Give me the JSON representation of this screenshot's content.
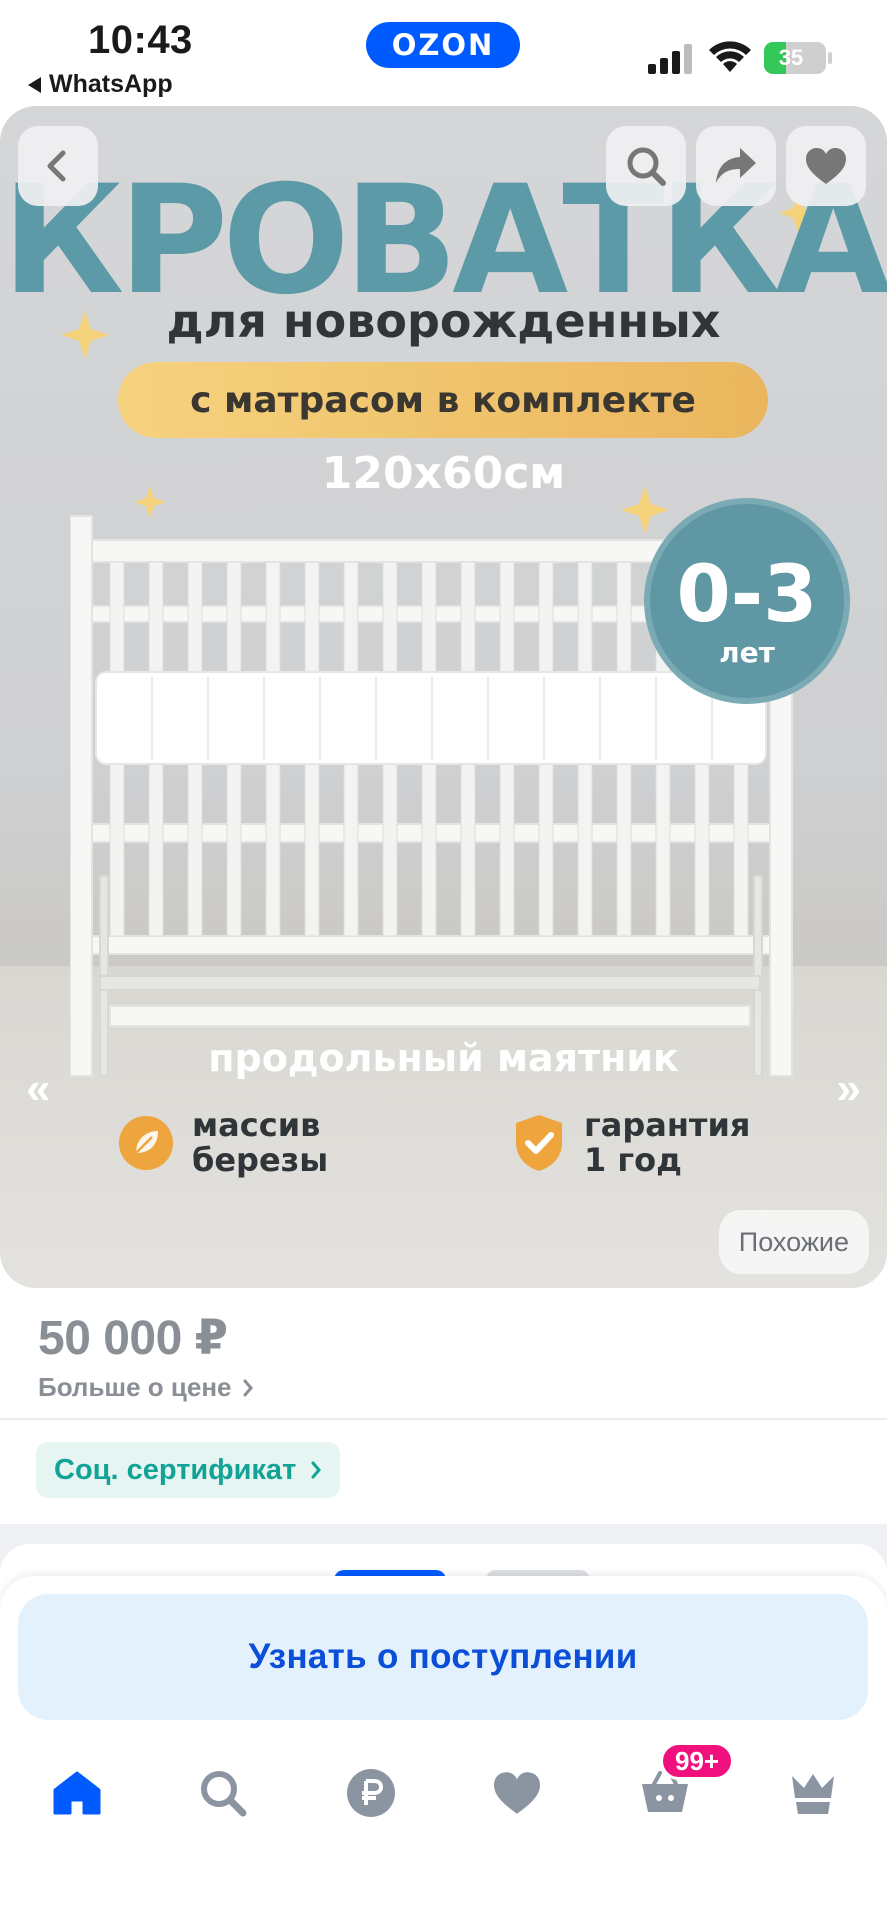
{
  "status_bar": {
    "time": "10:43",
    "back_app": "WhatsApp",
    "brand": "OZON",
    "battery_percent": "35",
    "battery_level": 0.35
  },
  "hero": {
    "title": "КРОВАТКА",
    "subtitle": "для новорожденных",
    "pill": "с матрасом в комплекте",
    "size": "120х60см",
    "age_value": "0-3",
    "age_unit": "лет",
    "pendulum": "продольный маятник",
    "feature_1_line1": "массив",
    "feature_1_line2": "березы",
    "feature_2_line1": "гарантия",
    "feature_2_line2": "1 год",
    "similar_label": "Похожие",
    "arrow_left": "«",
    "arrow_right": "»"
  },
  "icons": {
    "back": "chevron-left-icon",
    "search": "search-icon",
    "share": "share-arrow-icon",
    "favorite": "heart-icon"
  },
  "price": {
    "value": "50 000 ₽",
    "more_label": "Больше о цене"
  },
  "certificate": {
    "label": "Соц. сертификат"
  },
  "bottom_sheet": {
    "notify_label": "Узнать о поступлении"
  },
  "tabbar": {
    "items": [
      "home-icon",
      "search-icon",
      "ruble-icon",
      "heart-icon",
      "cart-icon",
      "crown-icon"
    ],
    "cart_badge": "99+"
  },
  "colors": {
    "accent": "#005bff",
    "teal": "#5f98a4",
    "cert_text": "#11a396",
    "badge": "#f1117e"
  }
}
